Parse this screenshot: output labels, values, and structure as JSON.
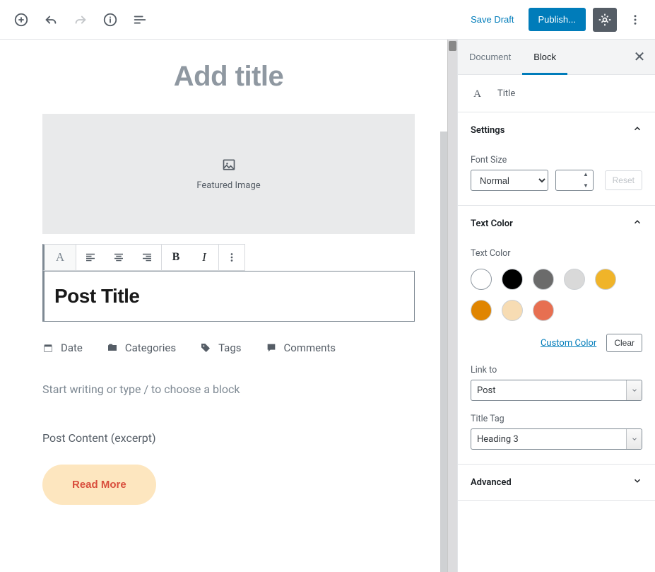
{
  "topbar": {
    "save_draft": "Save Draft",
    "publish": "Publish..."
  },
  "editor": {
    "title_placeholder": "Add title",
    "featured_image_label": "Featured Image",
    "post_title": "Post Title",
    "meta": {
      "date": "Date",
      "categories": "Categories",
      "tags": "Tags",
      "comments": "Comments"
    },
    "block_placeholder": "Start writing or type / to choose a block",
    "excerpt_label": "Post Content (excerpt)",
    "read_more": "Read More"
  },
  "sidebar": {
    "tabs": {
      "document": "Document",
      "block": "Block"
    },
    "block_type": "Title",
    "panels": {
      "settings": {
        "title": "Settings",
        "font_size_label": "Font Size",
        "font_size_value": "Normal",
        "reset": "Reset"
      },
      "text_color": {
        "title": "Text Color",
        "label": "Text Color",
        "swatches": [
          "#ffffff",
          "#000000",
          "#6b6b6b",
          "#d9d9d9",
          "#f0b429",
          "#e08500",
          "#f7dcb3",
          "#e76f51"
        ],
        "custom": "Custom Color",
        "clear": "Clear",
        "link_to_label": "Link to",
        "link_to_value": "Post",
        "title_tag_label": "Title Tag",
        "title_tag_value": "Heading 3"
      },
      "advanced": {
        "title": "Advanced"
      }
    }
  }
}
